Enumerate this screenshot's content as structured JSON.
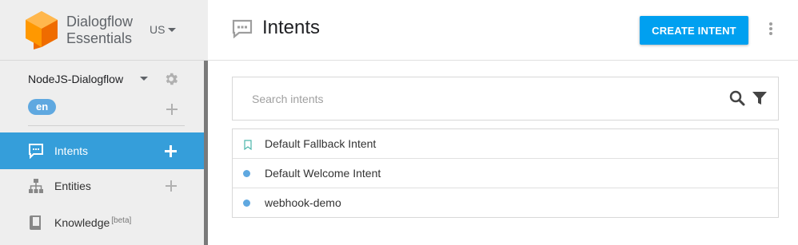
{
  "brand": {
    "line1": "Dialogflow",
    "line2": "Essentials",
    "region": "US",
    "logo_color": "#f57c1f"
  },
  "agent": {
    "name": "NodeJS-Dialogflow",
    "language": "en"
  },
  "nav": [
    {
      "label": "Intents",
      "icon": "chat-icon",
      "active": true
    },
    {
      "label": "Entities",
      "icon": "hierarchy-icon"
    },
    {
      "label": "Knowledge",
      "badge": "[beta]",
      "icon": "book-icon"
    }
  ],
  "header": {
    "title": "Intents",
    "create_label": "CREATE INTENT"
  },
  "search": {
    "placeholder": "Search intents",
    "value": ""
  },
  "intents": [
    {
      "name": "Default Fallback Intent",
      "marker": "bookmark"
    },
    {
      "name": "Default Welcome Intent",
      "marker": "dot"
    },
    {
      "name": "webhook-demo",
      "marker": "dot"
    }
  ],
  "colors": {
    "accent": "#359eda",
    "button": "#00a0f0",
    "chip": "#5fa8e0",
    "fallback_marker": "#4db6ac"
  }
}
